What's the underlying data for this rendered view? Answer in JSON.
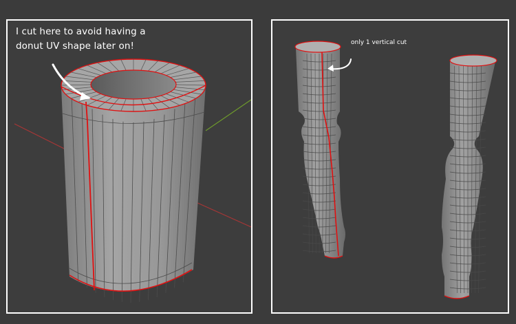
{
  "annotations": {
    "left_note": "I cut here to avoid having a\ndonut UV shape later on!",
    "right_note": "only 1 vertical cut"
  },
  "colors": {
    "background": "#3b3b3b",
    "panel_border": "#ffffff",
    "mesh_body": "#8f8f8f",
    "mesh_edge": "#4a4a4a",
    "seam": "#e01010",
    "axis_x": "#b03a3a",
    "axis_y": "#6e9a2c"
  },
  "icons": {
    "left_arrow": "curved-arrow-icon",
    "right_arrow": "curved-arrow-icon"
  }
}
